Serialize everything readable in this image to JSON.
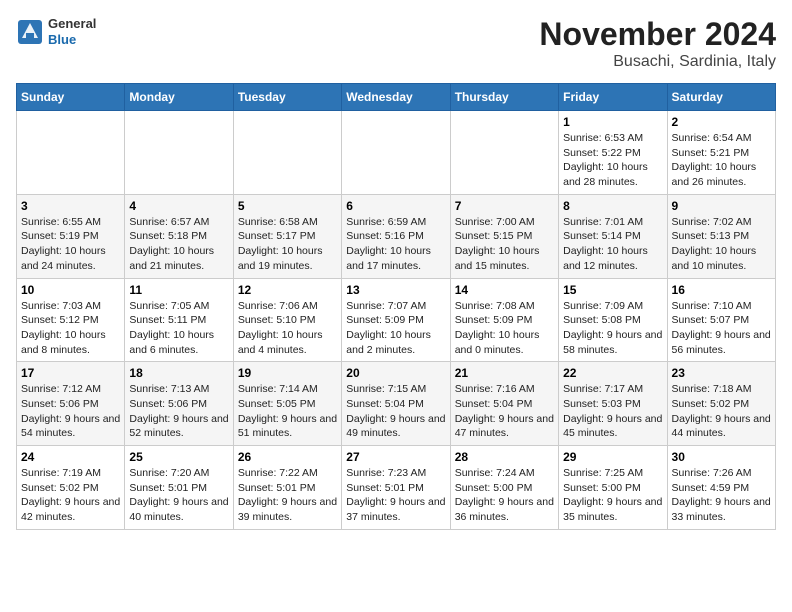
{
  "header": {
    "logo": {
      "general": "General",
      "blue": "Blue"
    },
    "title": "November 2024",
    "subtitle": "Busachi, Sardinia, Italy"
  },
  "days_of_week": [
    "Sunday",
    "Monday",
    "Tuesday",
    "Wednesday",
    "Thursday",
    "Friday",
    "Saturday"
  ],
  "weeks": [
    [
      {
        "day": "",
        "info": ""
      },
      {
        "day": "",
        "info": ""
      },
      {
        "day": "",
        "info": ""
      },
      {
        "day": "",
        "info": ""
      },
      {
        "day": "",
        "info": ""
      },
      {
        "day": "1",
        "info": "Sunrise: 6:53 AM\nSunset: 5:22 PM\nDaylight: 10 hours and 28 minutes."
      },
      {
        "day": "2",
        "info": "Sunrise: 6:54 AM\nSunset: 5:21 PM\nDaylight: 10 hours and 26 minutes."
      }
    ],
    [
      {
        "day": "3",
        "info": "Sunrise: 6:55 AM\nSunset: 5:19 PM\nDaylight: 10 hours and 24 minutes."
      },
      {
        "day": "4",
        "info": "Sunrise: 6:57 AM\nSunset: 5:18 PM\nDaylight: 10 hours and 21 minutes."
      },
      {
        "day": "5",
        "info": "Sunrise: 6:58 AM\nSunset: 5:17 PM\nDaylight: 10 hours and 19 minutes."
      },
      {
        "day": "6",
        "info": "Sunrise: 6:59 AM\nSunset: 5:16 PM\nDaylight: 10 hours and 17 minutes."
      },
      {
        "day": "7",
        "info": "Sunrise: 7:00 AM\nSunset: 5:15 PM\nDaylight: 10 hours and 15 minutes."
      },
      {
        "day": "8",
        "info": "Sunrise: 7:01 AM\nSunset: 5:14 PM\nDaylight: 10 hours and 12 minutes."
      },
      {
        "day": "9",
        "info": "Sunrise: 7:02 AM\nSunset: 5:13 PM\nDaylight: 10 hours and 10 minutes."
      }
    ],
    [
      {
        "day": "10",
        "info": "Sunrise: 7:03 AM\nSunset: 5:12 PM\nDaylight: 10 hours and 8 minutes."
      },
      {
        "day": "11",
        "info": "Sunrise: 7:05 AM\nSunset: 5:11 PM\nDaylight: 10 hours and 6 minutes."
      },
      {
        "day": "12",
        "info": "Sunrise: 7:06 AM\nSunset: 5:10 PM\nDaylight: 10 hours and 4 minutes."
      },
      {
        "day": "13",
        "info": "Sunrise: 7:07 AM\nSunset: 5:09 PM\nDaylight: 10 hours and 2 minutes."
      },
      {
        "day": "14",
        "info": "Sunrise: 7:08 AM\nSunset: 5:09 PM\nDaylight: 10 hours and 0 minutes."
      },
      {
        "day": "15",
        "info": "Sunrise: 7:09 AM\nSunset: 5:08 PM\nDaylight: 9 hours and 58 minutes."
      },
      {
        "day": "16",
        "info": "Sunrise: 7:10 AM\nSunset: 5:07 PM\nDaylight: 9 hours and 56 minutes."
      }
    ],
    [
      {
        "day": "17",
        "info": "Sunrise: 7:12 AM\nSunset: 5:06 PM\nDaylight: 9 hours and 54 minutes."
      },
      {
        "day": "18",
        "info": "Sunrise: 7:13 AM\nSunset: 5:06 PM\nDaylight: 9 hours and 52 minutes."
      },
      {
        "day": "19",
        "info": "Sunrise: 7:14 AM\nSunset: 5:05 PM\nDaylight: 9 hours and 51 minutes."
      },
      {
        "day": "20",
        "info": "Sunrise: 7:15 AM\nSunset: 5:04 PM\nDaylight: 9 hours and 49 minutes."
      },
      {
        "day": "21",
        "info": "Sunrise: 7:16 AM\nSunset: 5:04 PM\nDaylight: 9 hours and 47 minutes."
      },
      {
        "day": "22",
        "info": "Sunrise: 7:17 AM\nSunset: 5:03 PM\nDaylight: 9 hours and 45 minutes."
      },
      {
        "day": "23",
        "info": "Sunrise: 7:18 AM\nSunset: 5:02 PM\nDaylight: 9 hours and 44 minutes."
      }
    ],
    [
      {
        "day": "24",
        "info": "Sunrise: 7:19 AM\nSunset: 5:02 PM\nDaylight: 9 hours and 42 minutes."
      },
      {
        "day": "25",
        "info": "Sunrise: 7:20 AM\nSunset: 5:01 PM\nDaylight: 9 hours and 40 minutes."
      },
      {
        "day": "26",
        "info": "Sunrise: 7:22 AM\nSunset: 5:01 PM\nDaylight: 9 hours and 39 minutes."
      },
      {
        "day": "27",
        "info": "Sunrise: 7:23 AM\nSunset: 5:01 PM\nDaylight: 9 hours and 37 minutes."
      },
      {
        "day": "28",
        "info": "Sunrise: 7:24 AM\nSunset: 5:00 PM\nDaylight: 9 hours and 36 minutes."
      },
      {
        "day": "29",
        "info": "Sunrise: 7:25 AM\nSunset: 5:00 PM\nDaylight: 9 hours and 35 minutes."
      },
      {
        "day": "30",
        "info": "Sunrise: 7:26 AM\nSunset: 4:59 PM\nDaylight: 9 hours and 33 minutes."
      }
    ]
  ]
}
